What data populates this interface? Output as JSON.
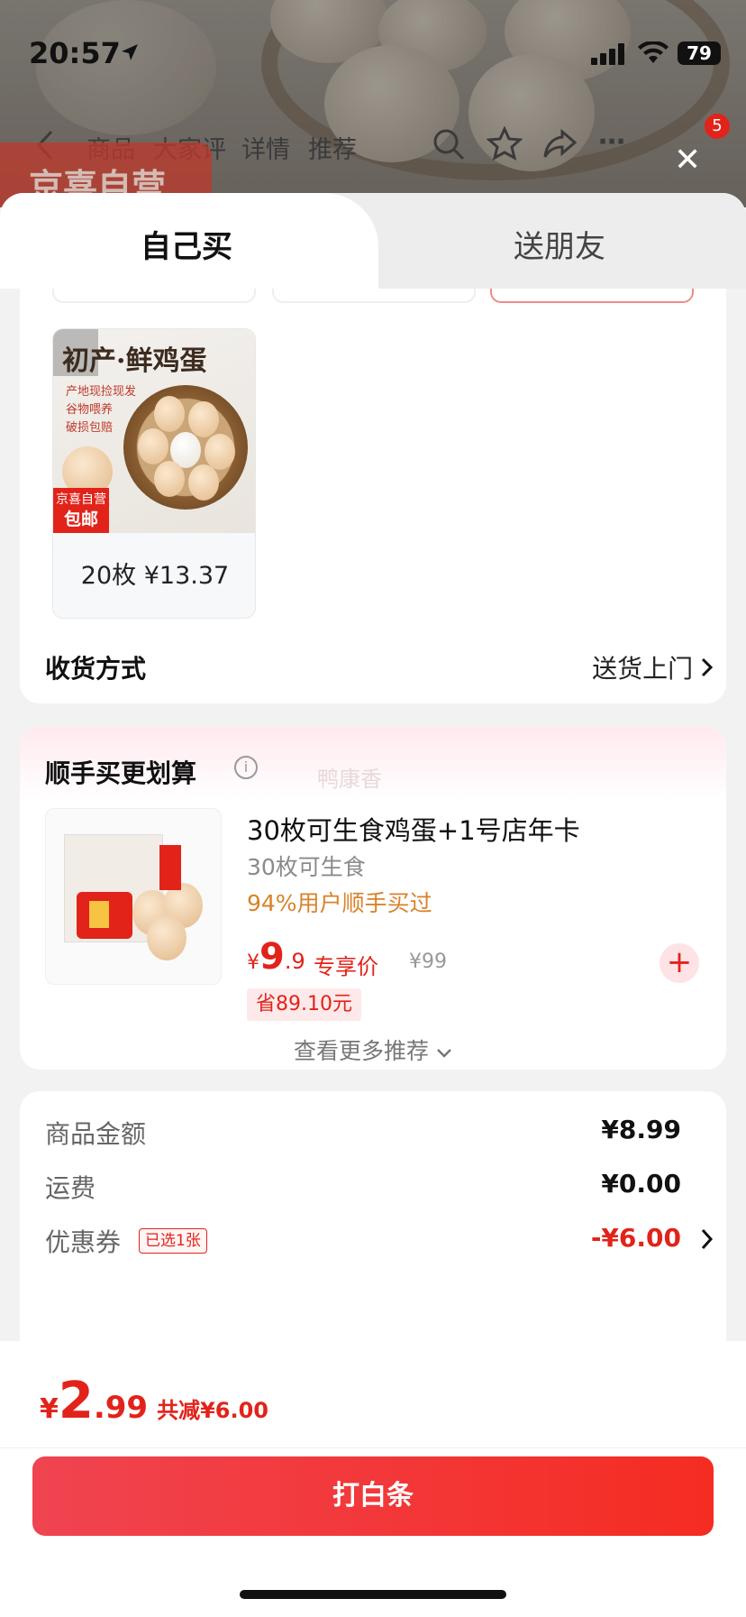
{
  "status": {
    "time": "20:57",
    "battery": "79"
  },
  "top_nav": {
    "items": [
      "商品",
      "大家评",
      "详情",
      "推荐"
    ],
    "cart_count": "5",
    "brand": "京喜自营"
  },
  "tabs": {
    "self": "自己买",
    "gift": "送朋友"
  },
  "product": {
    "image_title": "初产·鲜鸡蛋",
    "image_lines": [
      "产地现捡现发",
      "谷物喂养",
      "破损包赔"
    ],
    "badge_top": "京喜自营",
    "badge_bottom": "包邮",
    "label": "20枚  ¥13.37"
  },
  "shipping": {
    "label": "收货方式",
    "value": "送货上门"
  },
  "recommend": {
    "title": "顺手买更划算",
    "watermark": "鸭康香",
    "item": {
      "name": "30枚可生食鸡蛋+1号店年卡",
      "sub": "30枚可生食",
      "bought": "94%用户顺手买过",
      "price_symbol": "¥",
      "price_int": "9",
      "price_dec": ".9",
      "tag": "专享价",
      "original": "¥99",
      "save": "省89.10元"
    },
    "more": "查看更多推荐"
  },
  "fees": {
    "goods_label": "商品金额",
    "goods_value": "¥8.99",
    "freight_label": "运费",
    "freight_value": "¥0.00",
    "coupon_label": "优惠券",
    "coupon_badge": "已选1张",
    "coupon_value": "-¥6.00"
  },
  "footer": {
    "price_symbol": "¥",
    "price_int": "2",
    "price_dec": ".99",
    "save_text": "共减¥6.00",
    "button": "打白条"
  },
  "colors": {
    "accent": "#e2231a",
    "button_start": "#f04451",
    "button_end": "#f52c22"
  }
}
